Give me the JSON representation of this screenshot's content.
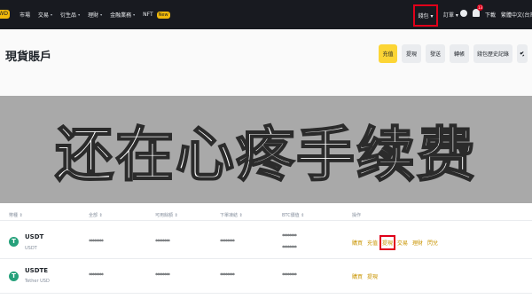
{
  "nav": {
    "logo_badge": "TWD",
    "items": [
      {
        "label": "市場",
        "caret": ""
      },
      {
        "label": "交易",
        "caret": "▾"
      },
      {
        "label": "衍生品",
        "caret": "▾"
      },
      {
        "label": "理財",
        "caret": "▾"
      },
      {
        "label": "金融業務",
        "caret": "▾"
      },
      {
        "label": "NFT",
        "caret": ""
      }
    ],
    "nft_badge": "New",
    "wallet": "錢包 ▾",
    "orders": "訂單 ▾",
    "notifications_count": "13",
    "download": "下載",
    "language": "繁體中文(台灣)"
  },
  "header": {
    "title": "現貨賬戶",
    "buttons": [
      "充值",
      "提現",
      "發送",
      "轉帳",
      "錢包歷史記錄"
    ]
  },
  "banner": {
    "text": "还在心疼手续费"
  },
  "table": {
    "columns": [
      "幣種 ⇕",
      "全部 ⇕",
      "可用餘額 ⇕",
      "下單凍結 ⇕",
      "BTC價值 ⇕",
      "操作"
    ],
    "rows": [
      {
        "symbol": "USDT",
        "name": "USDT",
        "total": "********",
        "available": "********",
        "in_order": "********",
        "btc_value_1": "********",
        "btc_value_2": "********",
        "actions": [
          "購買",
          "充值",
          "提現",
          "交易",
          "理財",
          "閃兌"
        ]
      },
      {
        "symbol": "USDTE",
        "name": "Tether USD",
        "total": "********",
        "available": "********",
        "in_order": "********",
        "btc_value_1": "********",
        "actions": [
          "購買",
          "提現"
        ]
      }
    ]
  },
  "colors": {
    "accent": "#fcd535",
    "nav_bg": "#181a20",
    "highlight": "#e0001a",
    "coin": "#26a17b",
    "action_text": "#c99400"
  }
}
